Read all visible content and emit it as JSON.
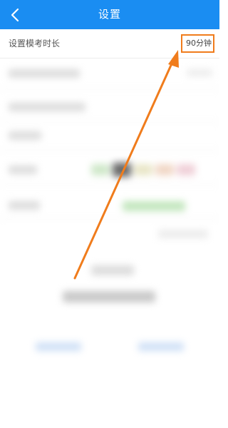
{
  "header": {
    "title": "设置",
    "back_icon": "chevron-left-icon",
    "background": "#1a8df2"
  },
  "setting": {
    "label": "设置模考时长",
    "value": "90分钟"
  },
  "annotation": {
    "color": "#f07c1c",
    "icon": "arrow-annotation"
  }
}
